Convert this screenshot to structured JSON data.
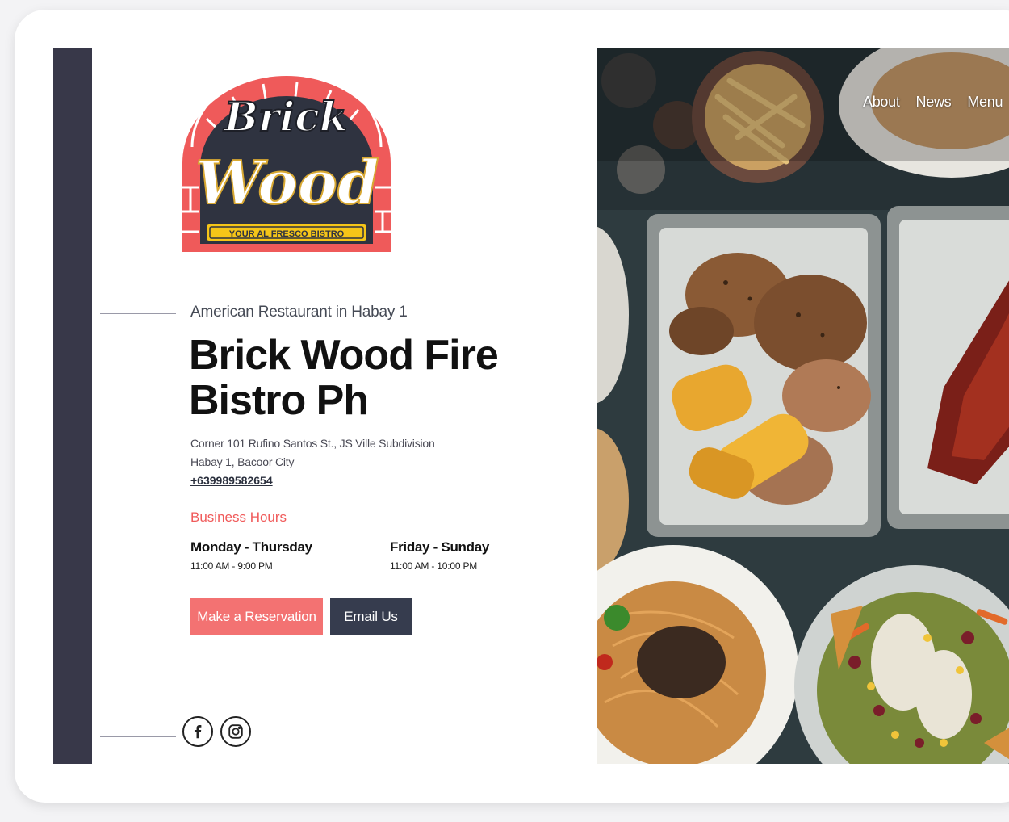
{
  "brand": {
    "logo_line1": "Brick",
    "logo_line2": "Wood",
    "tagline": "YOUR AL FRESCO BISTRO"
  },
  "hero_text": {
    "subtitle": "American Restaurant in Habay 1",
    "title": "Brick Wood Fire Bistro Ph",
    "address_line1": "Corner 101 Rufino Santos St., JS Ville Subdivision",
    "address_line2": "Habay 1, Bacoor City",
    "phone": "+639989582654"
  },
  "hours": {
    "heading": "Business Hours",
    "blocks": [
      {
        "days": "Monday - Thursday",
        "time": "11:00 AM - 9:00 PM"
      },
      {
        "days": "Friday - Sunday",
        "time": "11:00 AM - 10:00 PM"
      }
    ]
  },
  "actions": {
    "reserve_label": "Make a Reservation",
    "email_label": "Email Us"
  },
  "nav": {
    "items": [
      "About",
      "News",
      "Menu"
    ]
  },
  "social": {
    "icons": [
      "facebook-icon",
      "instagram-icon"
    ]
  },
  "colors": {
    "accent": "#f37272",
    "dark": "#383849",
    "button_dark": "#363c4e",
    "heading_red": "#f05a5a"
  }
}
